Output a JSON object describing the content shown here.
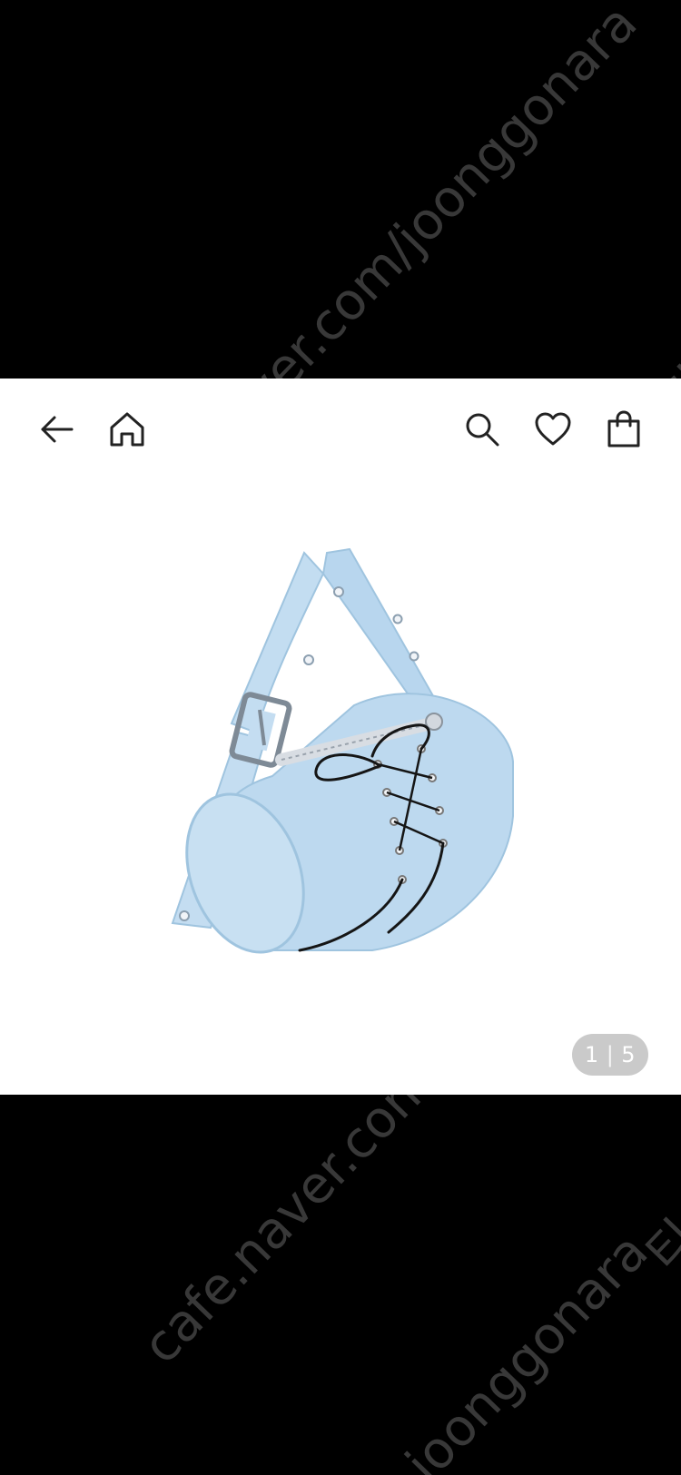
{
  "watermarks": {
    "url_full": "cafe.naver.com/joonggonara",
    "url_tail": "ver.com/joonggonara",
    "mark": "티",
    "short": "joonggonara"
  },
  "icons": {
    "back": "back-arrow-icon",
    "home": "home-icon",
    "search": "search-icon",
    "favorite": "heart-icon",
    "cart": "shopping-bag-icon"
  },
  "gallery": {
    "current": "1",
    "separator": "|",
    "total": "5"
  },
  "colors": {
    "background": "#000000",
    "panel": "#ffffff",
    "bag": "#bdd9ef",
    "lace": "#111111",
    "counter": "#aaaaaa"
  }
}
